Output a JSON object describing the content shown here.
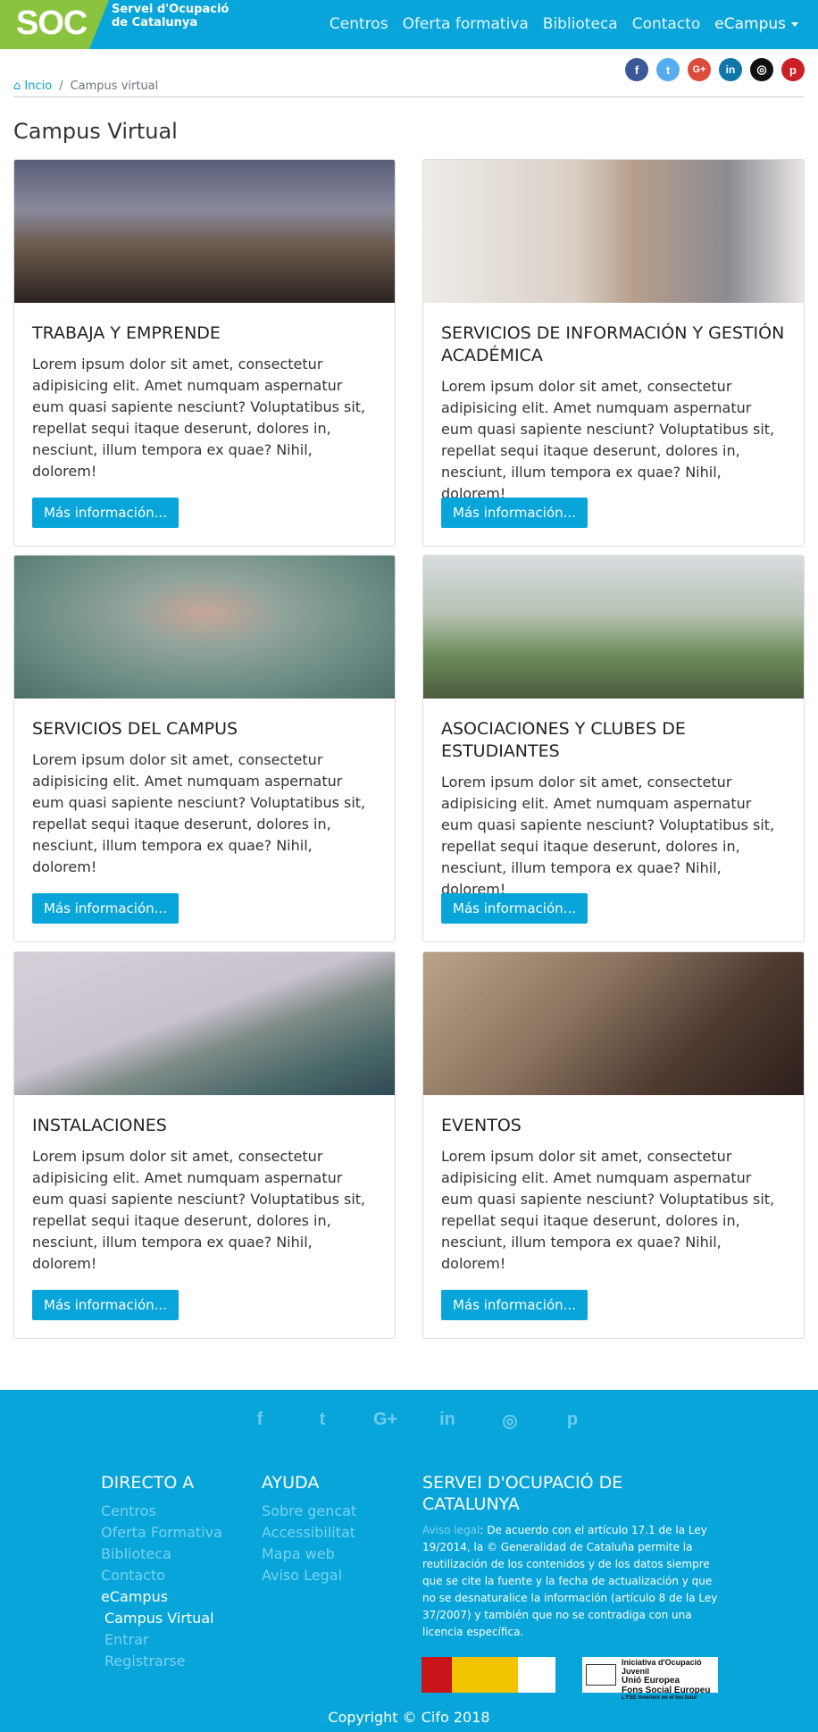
{
  "brand": {
    "logo": "SOC",
    "line1": "Servei d'Ocupació",
    "line2": "de Catalunya"
  },
  "nav": {
    "items": [
      "Centros",
      "Oferta formativa",
      "Biblioteca",
      "Contacto"
    ],
    "ecampus": "eCampus"
  },
  "social": [
    {
      "name": "facebook",
      "glyph": "f",
      "color": "#3b5998"
    },
    {
      "name": "twitter",
      "glyph": "t",
      "color": "#55acee"
    },
    {
      "name": "google-plus",
      "glyph": "G+",
      "color": "#dd4b39"
    },
    {
      "name": "linkedin",
      "glyph": "in",
      "color": "#0e76a8"
    },
    {
      "name": "instagram",
      "glyph": "◎",
      "color": "#111111"
    },
    {
      "name": "pinterest",
      "glyph": "p",
      "color": "#cb2027"
    }
  ],
  "breadcrumb": {
    "home": "Incio",
    "sep": "/",
    "current": "Campus virtual"
  },
  "page": {
    "title": "Campus Virtual"
  },
  "cards": [
    {
      "title": "TRABAJA Y EMPRENDE",
      "text": "Lorem ipsum dolor sit amet, consectetur adipisicing elit. Amet numquam aspernatur eum quasi sapiente nesciunt? Voluptatibus sit, repellat sequi itaque deserunt, dolores in, nesciunt, illum tempora ex quae? Nihil, dolorem!",
      "button": "Más información..."
    },
    {
      "title": "SERVICIOS DE INFORMACIÓN Y GESTIÓN ACADÉMICA",
      "text": "Lorem ipsum dolor sit amet, consectetur adipisicing elit. Amet numquam aspernatur eum quasi sapiente nesciunt? Voluptatibus sit, repellat sequi itaque deserunt, dolores in, nesciunt, illum tempora ex quae? Nihil, dolorem!",
      "button": "Más información..."
    },
    {
      "title": "SERVICIOS DEL CAMPUS",
      "text": "Lorem ipsum dolor sit amet, consectetur adipisicing elit. Amet numquam aspernatur eum quasi sapiente nesciunt? Voluptatibus sit, repellat sequi itaque deserunt, dolores in, nesciunt, illum tempora ex quae? Nihil, dolorem!",
      "button": "Más información..."
    },
    {
      "title": "ASOCIACIONES Y CLUBES DE ESTUDIANTES",
      "text": "Lorem ipsum dolor sit amet, consectetur adipisicing elit. Amet numquam aspernatur eum quasi sapiente nesciunt? Voluptatibus sit, repellat sequi itaque deserunt, dolores in, nesciunt, illum tempora ex quae? Nihil, dolorem!",
      "button": "Más información..."
    },
    {
      "title": "INSTALACIONES",
      "text": "Lorem ipsum dolor sit amet, consectetur adipisicing elit. Amet numquam aspernatur eum quasi sapiente nesciunt? Voluptatibus sit, repellat sequi itaque deserunt, dolores in, nesciunt, illum tempora ex quae? Nihil, dolorem!",
      "button": "Más información..."
    },
    {
      "title": "EVENTOS",
      "text": "Lorem ipsum dolor sit amet, consectetur adipisicing elit. Amet numquam aspernatur eum quasi sapiente nesciunt? Voluptatibus sit, repellat sequi itaque deserunt, dolores in, nesciunt, illum tempora ex quae? Nihil, dolorem!",
      "button": "Más información..."
    }
  ],
  "footer": {
    "icons": [
      "f",
      "t",
      "G+",
      "in",
      "◎",
      "p"
    ],
    "directo": {
      "title": "DIRECTO A",
      "links": [
        "Centros",
        "Oferta Formativa",
        "Biblioteca",
        "Contacto"
      ],
      "ecampus": "eCampus",
      "sub": [
        "Campus Virtual",
        "Entrar",
        "Registrarse"
      ]
    },
    "ayuda": {
      "title": "AYUDA",
      "links": [
        "Sobre gencat",
        "Accessibilitat",
        "Mapa web",
        "Aviso Legal"
      ]
    },
    "soc": {
      "title": "SERVEI D'OCUPACIÓ DE CATALUNYA",
      "aviso": "Aviso legal",
      "text": ": De acuerdo con el artículo 17.1 de la Ley 19/2014, la © Generalidad de Cataluña permite la reutilización de los contenidos y de los datos siempre que se cite la fuente y la fecha de actualización y que no se desnaturalice la información (artículo 8 de la Ley 37/2007) y también que no se contradiga con una licencia específica."
    },
    "badge": {
      "line1": "Iniciativa d'Ocupació Juvenil",
      "line2": "Unió Europea",
      "line3": "Fons Social Europeu",
      "line4": "L'FSE inverteix en el teu futur"
    },
    "copyright": "Copyright © Cifo 2018"
  }
}
